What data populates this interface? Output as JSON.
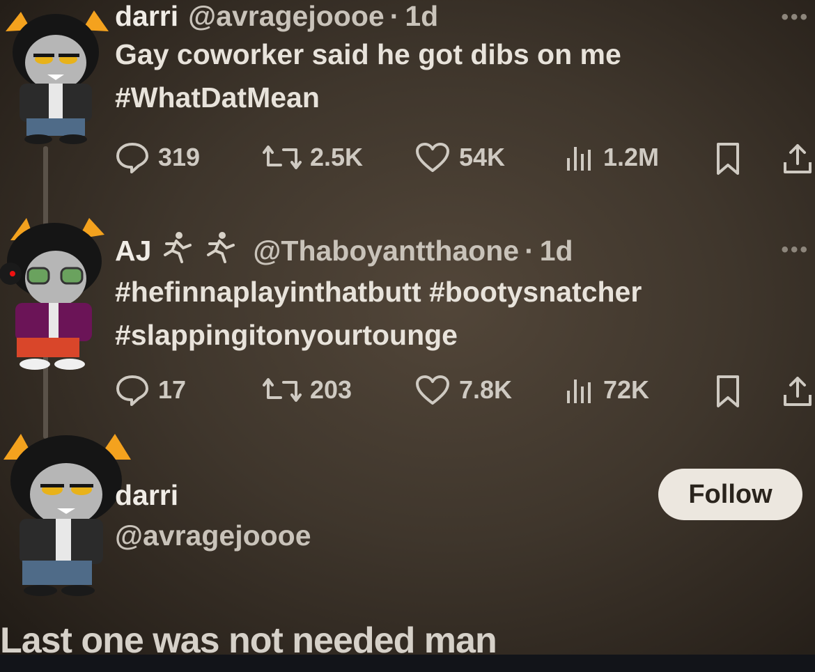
{
  "tweets": [
    {
      "name": "darri",
      "handle": "@avragejoooe",
      "age": "1d",
      "text_line1": "Gay coworker said he got dibs on me",
      "text_line2": "#WhatDatMean",
      "stats": {
        "replies": "319",
        "reposts": "2.5K",
        "likes": "54K",
        "views": "1.2M"
      }
    },
    {
      "name": "AJ",
      "emoji": "running-figure-icon",
      "handle": "@Thaboyantthaone",
      "age": "1d",
      "text_line1": "#hefinnaplayinthatbutt #bootysnatcher",
      "text_line2": "#slappingitonyourtounge",
      "stats": {
        "replies": "17",
        "reposts": "203",
        "likes": "7.8K",
        "views": "72K"
      }
    }
  ],
  "profile": {
    "name": "darri",
    "handle": "@avragejoooe",
    "follow_label": "Follow"
  },
  "caption": "Last one was not needed man",
  "colors": {
    "background": "#3f362c",
    "follow_button": "#ece7df",
    "text": "#e6e1d9"
  }
}
